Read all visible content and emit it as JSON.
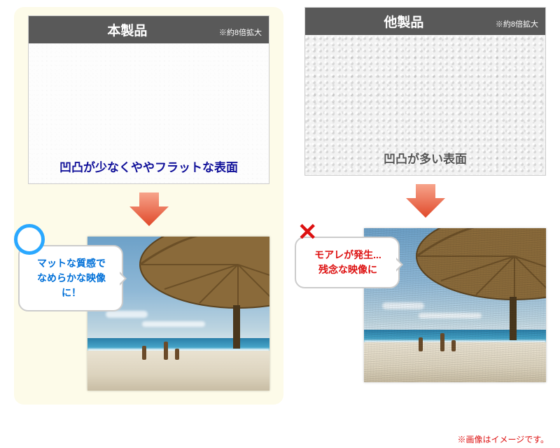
{
  "left": {
    "title": "本製品",
    "zoom": "※約8倍拡大",
    "texture_caption": "凹凸が少なくややフラットな表面",
    "speech_line1": "マットな質感で",
    "speech_line2": "なめらかな映像に！"
  },
  "right": {
    "title": "他製品",
    "zoom": "※約8倍拡大",
    "texture_caption": "凹凸が多い表面",
    "speech_line1": "モアレが発生...",
    "speech_line2": "残念な映像に"
  },
  "disclaimer": "※画像はイメージです。"
}
